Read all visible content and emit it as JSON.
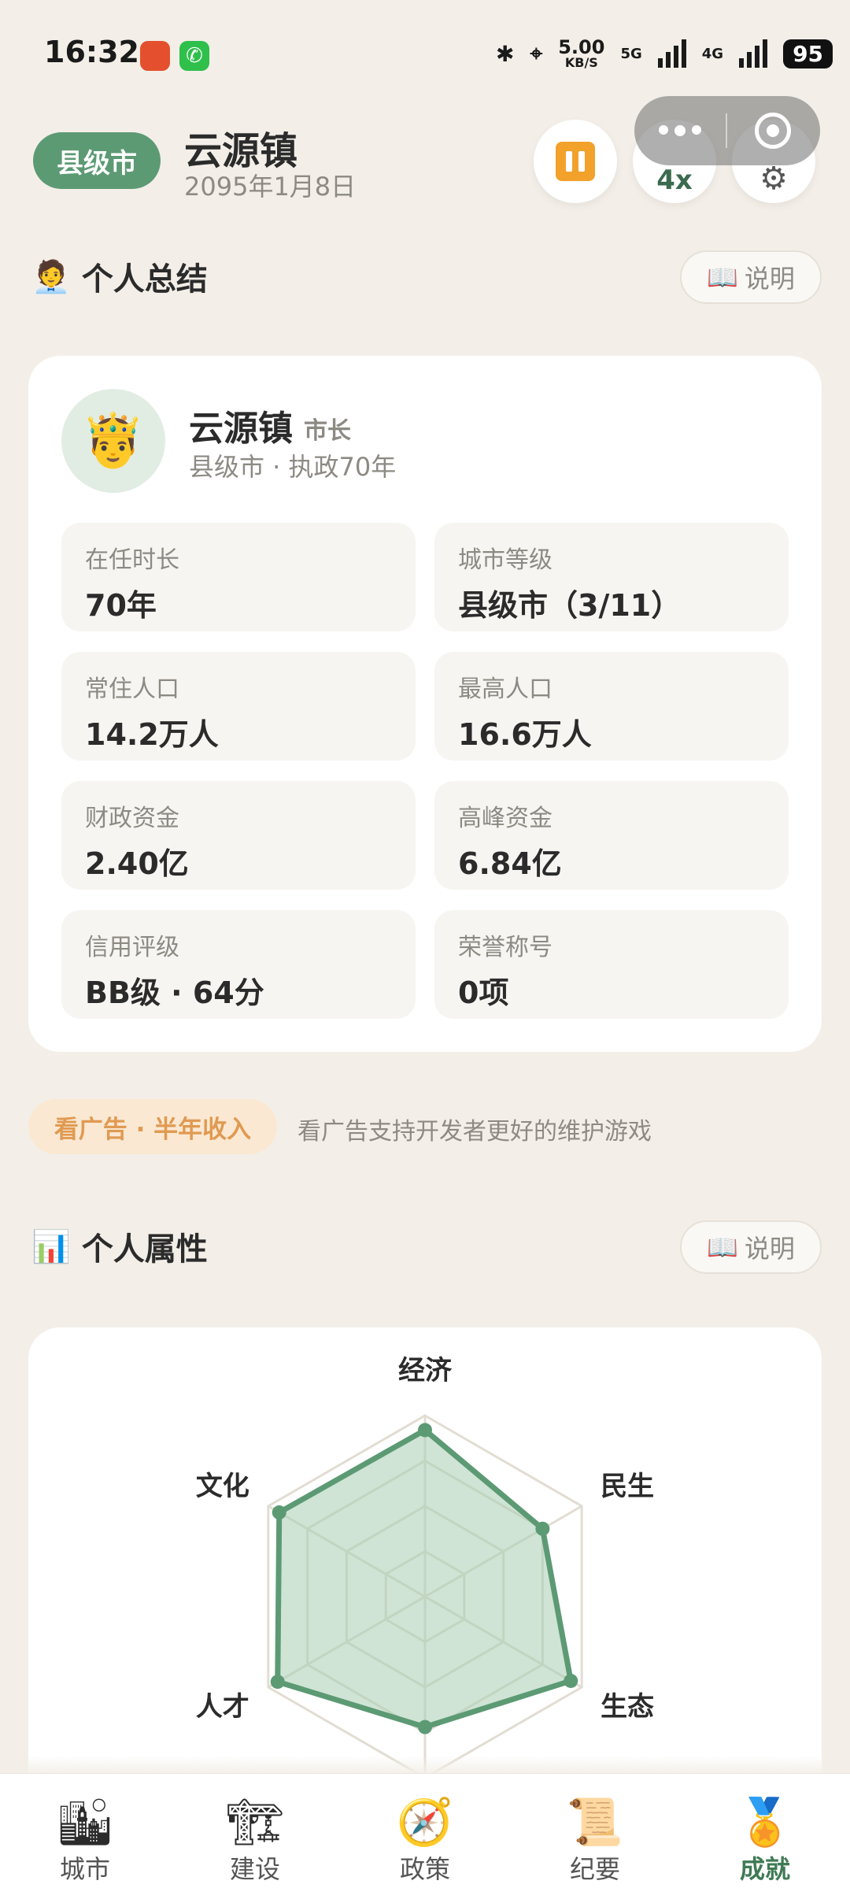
{
  "status_bar": {
    "time": "16:32",
    "net_speed": "5.00",
    "net_unit": "KB/S",
    "net_5g": "5G",
    "net_4g": "4G",
    "battery": "95"
  },
  "header": {
    "level_chip": "县级市",
    "town_name": "云源镇",
    "date": "2095年1月8日",
    "speed_label": "4x"
  },
  "summary": {
    "title": "个人总结",
    "emoji": "🧑‍💼",
    "help_label": "说明",
    "mayor_name": "云源镇",
    "mayor_role": "市长",
    "mayor_sub": "县级市 · 执政70年",
    "stats": [
      {
        "label": "在任时长",
        "value": "70年"
      },
      {
        "label": "城市等级",
        "value": "县级市（3/11）"
      },
      {
        "label": "常住人口",
        "value": "14.2万人"
      },
      {
        "label": "最高人口",
        "value": "16.6万人"
      },
      {
        "label": "财政资金",
        "value": "2.40亿"
      },
      {
        "label": "高峰资金",
        "value": "6.84亿"
      },
      {
        "label": "信用评级",
        "value": "BB级 · 64分"
      },
      {
        "label": "荣誉称号",
        "value": "0项"
      }
    ]
  },
  "ad": {
    "button": "看广告 · 半年收入",
    "text": "看广告支持开发者更好的维护游戏"
  },
  "attributes": {
    "title": "个人属性",
    "emoji": "📊",
    "help_label": "说明"
  },
  "chart_data": {
    "type": "radar",
    "axes": [
      "经济",
      "民生",
      "生态",
      "人才",
      "文化"
    ],
    "values": [
      0.92,
      0.75,
      0.93,
      0.72,
      0.94,
      0.93
    ],
    "value_axes_note": "sixth axis hidden below fold",
    "max": 1,
    "rings": 4,
    "colors": {
      "fill": "#a7cdb2",
      "stroke": "#5c9a74",
      "grid": "#e2ddd2"
    }
  },
  "tabs": [
    {
      "label": "城市",
      "icon": "city-icon"
    },
    {
      "label": "建设",
      "icon": "crane-icon"
    },
    {
      "label": "政策",
      "icon": "compass-icon"
    },
    {
      "label": "纪要",
      "icon": "scroll-icon"
    },
    {
      "label": "成就",
      "icon": "medal-icon",
      "active": true
    }
  ]
}
